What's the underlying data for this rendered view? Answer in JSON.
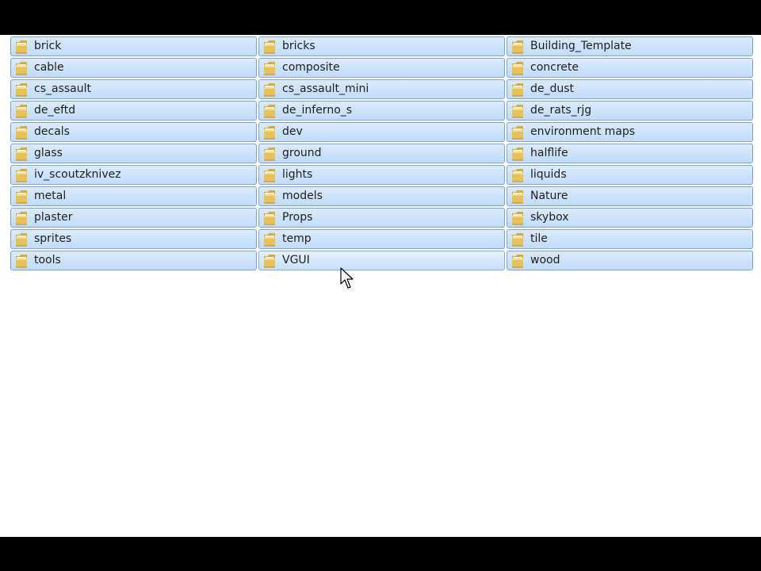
{
  "folders": [
    [
      "brick",
      "bricks",
      "Building_Template"
    ],
    [
      "cable",
      "composite",
      "concrete"
    ],
    [
      "cs_assault",
      "cs_assault_mini",
      "de_dust"
    ],
    [
      "de_eftd",
      "de_inferno_s",
      "de_rats_rjg"
    ],
    [
      "decals",
      "dev",
      "environment maps"
    ],
    [
      "glass",
      "ground",
      "halflife"
    ],
    [
      "iv_scoutzknivez",
      "lights",
      "liquids"
    ],
    [
      "metal",
      "models",
      "Nature"
    ],
    [
      "plaster",
      "Props",
      "skybox"
    ],
    [
      "sprites",
      "temp",
      "tile"
    ],
    [
      "tools",
      "VGUI",
      "wood"
    ]
  ],
  "icons": {
    "folder": "folder-icon",
    "cursor": "mouse-pointer-icon"
  },
  "colors": {
    "item_background": "#cde3fb",
    "item_border": "#7da2ce",
    "folder_yellow": "#e8c15a"
  }
}
